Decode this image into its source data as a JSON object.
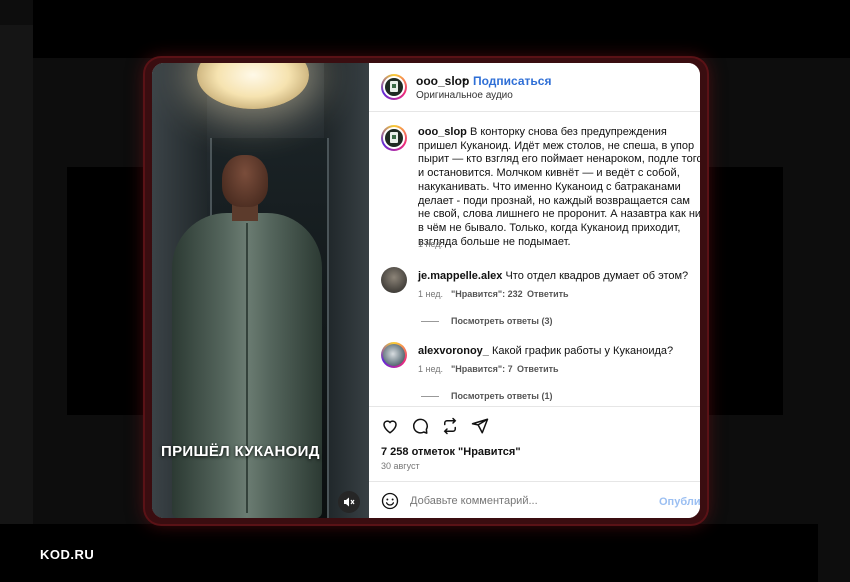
{
  "media": {
    "caption": "ПРИШЁЛ КУКАНОИД",
    "mute_icon": "speaker-muted-icon"
  },
  "header": {
    "username": "ooo_slop",
    "separator": "•",
    "follow_label": "Подписаться",
    "audio_label": "Оригинальное аудио"
  },
  "post": {
    "username": "ooo_slop",
    "text": "В конторку снова без предупреждения пришел Куканоид. Идёт меж столов, не спеша, в упор пырит — кто взгляд его поймает ненароком, подле того и остановится. Молчком кивнёт — и ведёт с собой, накуканивать. Что именно Куканоид с батраканами делает - поди прознай, но каждый возвращается сам не свой, слова лишнего не проронит. А назавтра как ни в чём не бывало. Только, когда Куканоид приходит, взгляда больше не подымает.",
    "time": "1 нед."
  },
  "comments": [
    {
      "username": "je.mappelle.alex",
      "text": "Что отдел квадров думает об этом?",
      "time": "1 нед.",
      "likes": "\"Нравится\": 232",
      "reply_label": "Ответить",
      "view_replies": "Посмотреть ответы (3)"
    },
    {
      "username": "alexvoronoy_",
      "text": "Какой график работы у Куканоида?",
      "time": "1 нед.",
      "likes": "\"Нравится\": 7",
      "reply_label": "Ответить",
      "view_replies": "Посмотреть ответы (1)"
    }
  ],
  "actions": {
    "icons": [
      "heart-icon",
      "comment-icon",
      "repost-icon",
      "share-icon"
    ],
    "likes_count": "7 258 отметок \"Нравится\"",
    "date": "30 август"
  },
  "comment_box": {
    "placeholder": "Добавьте комментарий...",
    "publish_label": "Опубликовать"
  },
  "footer": {
    "logo": "KOD.RU"
  },
  "colors": {
    "accent_link": "#2f6fd6",
    "frame_glow": "#5a1216",
    "publish_disabled": "#9bbff2"
  }
}
